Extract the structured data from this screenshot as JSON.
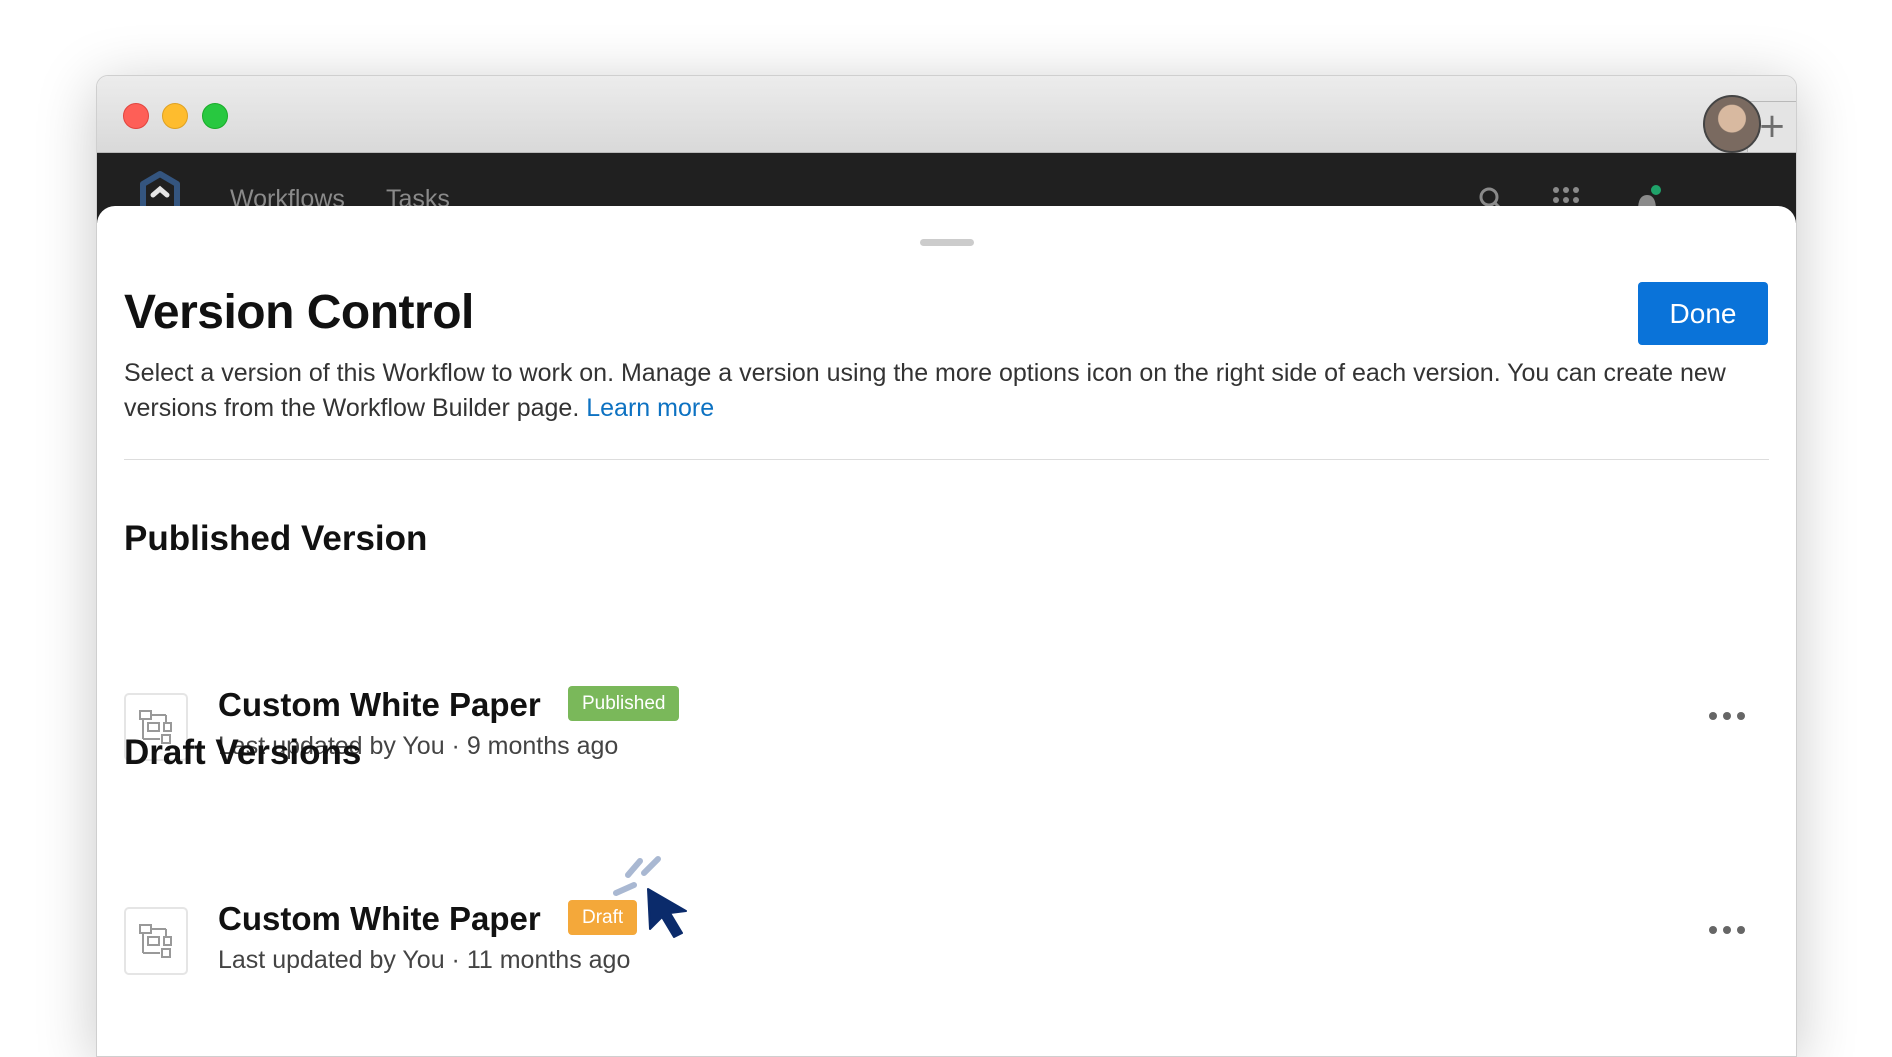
{
  "window": {
    "new_tab_label": "+"
  },
  "app_nav": {
    "links": [
      "Workflows",
      "Tasks"
    ],
    "icons": [
      "search-icon",
      "apps-grid-icon",
      "bell-icon"
    ],
    "notification_color": "#1fa36a"
  },
  "sheet": {
    "title": "Version Control",
    "done_label": "Done",
    "description": "Select a version of this Workflow to work on. Manage a version using the more options icon on the right side of each version. You can create new versions from the Workflow Builder page.",
    "learn_more": "Learn more",
    "published_heading": "Published Version",
    "drafts_heading": "Draft Versions",
    "published": [
      {
        "name": "Custom White Paper",
        "badge": "Published",
        "meta": "Last updated by You · 9 months ago"
      }
    ],
    "drafts": [
      {
        "name": "Custom White Paper",
        "badge": "Draft",
        "meta": "Last updated by You · 11 months ago"
      }
    ]
  },
  "colors": {
    "primary": "#0a73d9",
    "link": "#0d72c2",
    "published_badge": "#7ab85a",
    "draft_badge": "#f4a83a",
    "cursor": "#0b2b6b"
  }
}
